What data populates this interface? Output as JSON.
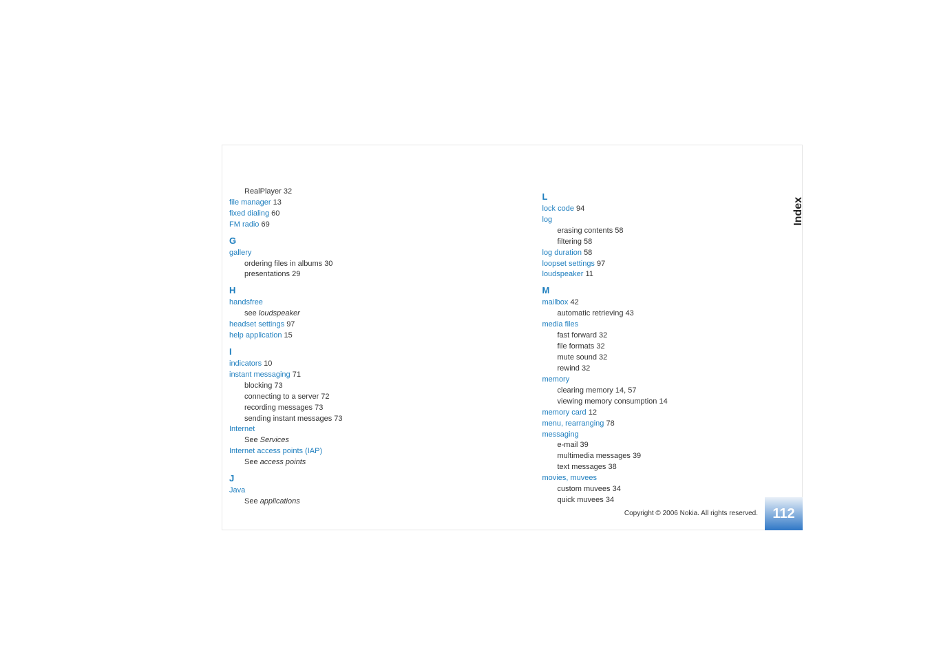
{
  "side_label": "Index",
  "page_number": "112",
  "copyright": "Copyright © 2006 Nokia. All rights reserved.",
  "col1": {
    "line_realplayer": "RealPlayer",
    "pg_realplayer": "32",
    "file_manager": "file manager",
    "pg_file_manager": "13",
    "fixed_dialing": "fixed dialing",
    "pg_fixed_dialing": "60",
    "fm_radio": "FM radio",
    "pg_fm_radio": "69",
    "G": "G",
    "gallery": "gallery",
    "gallery_sub1": "ordering files in albums",
    "pg_gallery_sub1": "30",
    "gallery_sub2": "presentations",
    "pg_gallery_sub2": "29",
    "H": "H",
    "handsfree": "handsfree",
    "handsfree_see": "see ",
    "handsfree_see_i": "loudspeaker",
    "headset_settings": "headset settings",
    "pg_headset_settings": "97",
    "help_app": "help application",
    "pg_help_app": "15",
    "I": "I",
    "indicators": "indicators",
    "pg_indicators": "10",
    "instant_messaging": "instant messaging",
    "pg_instant_messaging": "71",
    "im_sub1": "blocking",
    "pg_im_sub1": "73",
    "im_sub2": "connecting to a server",
    "pg_im_sub2": "72",
    "im_sub3": "recording messages",
    "pg_im_sub3": "73",
    "im_sub4": "sending instant messages",
    "pg_im_sub4": "73",
    "internet": "Internet",
    "internet_see": "See ",
    "internet_see_i": "Services",
    "iap": "Internet access points (IAP)",
    "iap_see": "See ",
    "iap_see_i": "access points",
    "J": "J",
    "java": "Java",
    "java_see": "See ",
    "java_see_i": "applications"
  },
  "col2": {
    "L": "L",
    "lock_code": "lock code",
    "pg_lock_code": "94",
    "log": "log",
    "log_sub1": "erasing contents",
    "pg_log_sub1": "58",
    "log_sub2": "filtering",
    "pg_log_sub2": "58",
    "log_duration": "log duration",
    "pg_log_duration": "58",
    "loopset": "loopset settings",
    "pg_loopset": "97",
    "loudspeaker": "loudspeaker",
    "pg_loudspeaker": "11",
    "M": "M",
    "mailbox": "mailbox",
    "pg_mailbox": "42",
    "mailbox_sub1": "automatic retrieving",
    "pg_mailbox_sub1": "43",
    "media_files": "media files",
    "mf_sub1": "fast forward",
    "pg_mf_sub1": "32",
    "mf_sub2": "file formats",
    "pg_mf_sub2": "32",
    "mf_sub3": "mute sound",
    "pg_mf_sub3": "32",
    "mf_sub4": "rewind",
    "pg_mf_sub4": "32",
    "memory": "memory",
    "mem_sub1": "clearing memory",
    "pg_mem_sub1": "14, 57",
    "mem_sub2": "viewing memory consumption",
    "pg_mem_sub2": "14",
    "memory_card": "memory card",
    "pg_memory_card": "12",
    "menu": "menu, rearranging",
    "pg_menu": "78",
    "messaging": "messaging",
    "msg_sub1": "e-mail",
    "pg_msg_sub1": "39",
    "msg_sub2": "multimedia messages",
    "pg_msg_sub2": "39",
    "msg_sub3": "text messages",
    "pg_msg_sub3": "38",
    "movies": "movies, muvees",
    "mov_sub1": "custom muvees",
    "pg_mov_sub1": "34",
    "mov_sub2": "quick muvees",
    "pg_mov_sub2": "34"
  }
}
